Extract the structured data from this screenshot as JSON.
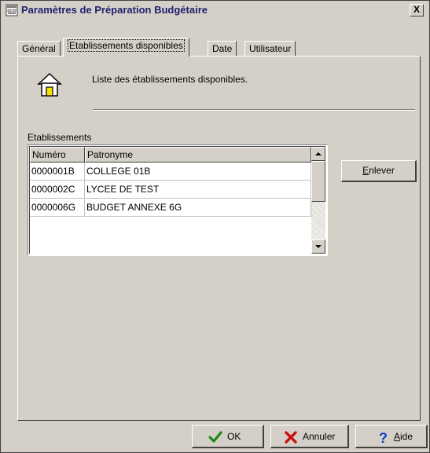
{
  "window": {
    "title": "Paramètres de Préparation Budgétaire",
    "close_glyph": "X"
  },
  "tabs": [
    {
      "label": "Général",
      "active": false
    },
    {
      "label": "Etablissements disponibles",
      "active": true
    },
    {
      "label": "Date",
      "active": false
    },
    {
      "label": "Utilisateur",
      "active": false
    }
  ],
  "panel": {
    "description": "Liste des établissements disponibles.",
    "group_label": "Etablissements",
    "icon": "house-icon"
  },
  "table": {
    "columns": [
      "Numéro",
      "Patronyme"
    ],
    "rows": [
      {
        "numero": "0000001B",
        "patronyme": "COLLEGE 01B"
      },
      {
        "numero": "0000002C",
        "patronyme": "LYCEE DE TEST"
      },
      {
        "numero": "0000006G",
        "patronyme": "BUDGET ANNEXE 6G"
      }
    ]
  },
  "buttons": {
    "remove": {
      "accel": "E",
      "rest": "nlever"
    },
    "ok": {
      "label": "OK",
      "icon": "check-icon"
    },
    "cancel": {
      "label": "Annuler",
      "icon": "x-cross-icon"
    },
    "help": {
      "accel": "A",
      "rest": "ide",
      "icon": "question-icon"
    }
  },
  "colors": {
    "window_bg": "#d4d0c8",
    "title_text": "#1f1f6e",
    "ok_check": "#1a8a1a",
    "cancel_cross": "#cc1010",
    "help_question": "#1040c0"
  }
}
